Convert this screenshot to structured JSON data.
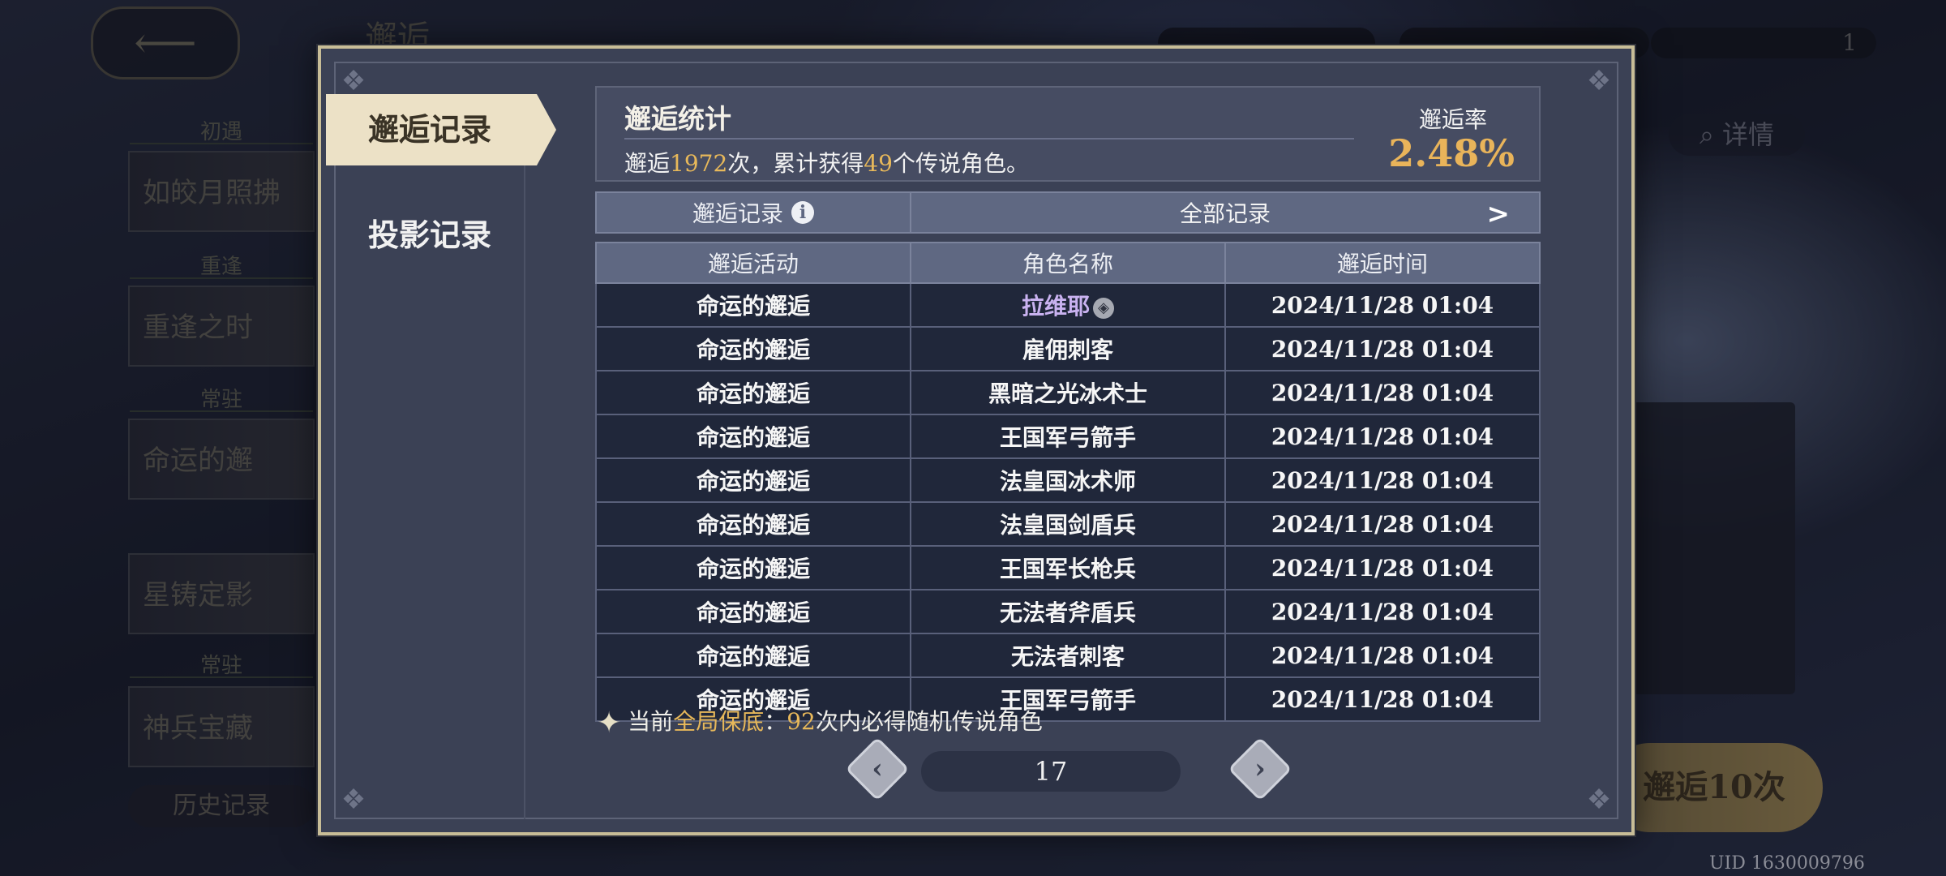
{
  "background": {
    "header_title": "邂逅",
    "top_counter_right": "1",
    "details_label": "详情",
    "side_tags": [
      "初遇",
      "重逢",
      "常驻",
      "常驻"
    ],
    "banners": [
      "如皎月照拂",
      "重逢之时",
      "命运的邂",
      "星铸定影",
      "神兵宝藏"
    ],
    "history_label": "历史记录",
    "draw10_label": "邂逅10次",
    "uid": "UID 1630009796"
  },
  "tabs": [
    {
      "label": "邂逅记录",
      "active": true
    },
    {
      "label": "投影记录",
      "active": false
    }
  ],
  "stats": {
    "title": "邂逅统计",
    "text_prefix": "邂逅",
    "total_draws": "1972",
    "text_middle": "次，累计获得",
    "legend_count": "49",
    "text_suffix": "个传说角色。",
    "rate_label": "邂逅率",
    "rate_value": "2.48%"
  },
  "filter": {
    "left_label": "邂逅记录",
    "right_label": "全部记录"
  },
  "table": {
    "headers": [
      "邂逅活动",
      "角色名称",
      "邂逅时间"
    ],
    "rows": [
      {
        "activity": "命运的邂逅",
        "name": "拉维耶",
        "time": "2024/11/28 01:04"
      },
      {
        "activity": "命运的邂逅",
        "name": "雇佣刺客",
        "time": "2024/11/28 01:04"
      },
      {
        "activity": "命运的邂逅",
        "name": "黑暗之光冰术士",
        "time": "2024/11/28 01:04"
      },
      {
        "activity": "命运的邂逅",
        "name": "王国军弓箭手",
        "time": "2024/11/28 01:04"
      },
      {
        "activity": "命运的邂逅",
        "name": "法皇国冰术师",
        "time": "2024/11/28 01:04"
      },
      {
        "activity": "命运的邂逅",
        "name": "法皇国剑盾兵",
        "time": "2024/11/28 01:04"
      },
      {
        "activity": "命运的邂逅",
        "name": "王国军长枪兵",
        "time": "2024/11/28 01:04"
      },
      {
        "activity": "命运的邂逅",
        "name": "无法者斧盾兵",
        "time": "2024/11/28 01:04"
      },
      {
        "activity": "命运的邂逅",
        "name": "无法者刺客",
        "time": "2024/11/28 01:04"
      },
      {
        "activity": "命运的邂逅",
        "name": "王国军弓箭手",
        "time": "2024/11/28 01:04"
      }
    ]
  },
  "guarantee": {
    "prefix": "当前",
    "highlight": "全局保底",
    "colon": "：",
    "count": "92",
    "suffix": "次内必得随机传说角色"
  },
  "pager": {
    "page": "17",
    "prev_icon": "chevron-left-icon",
    "next_icon": "chevron-right-icon"
  }
}
